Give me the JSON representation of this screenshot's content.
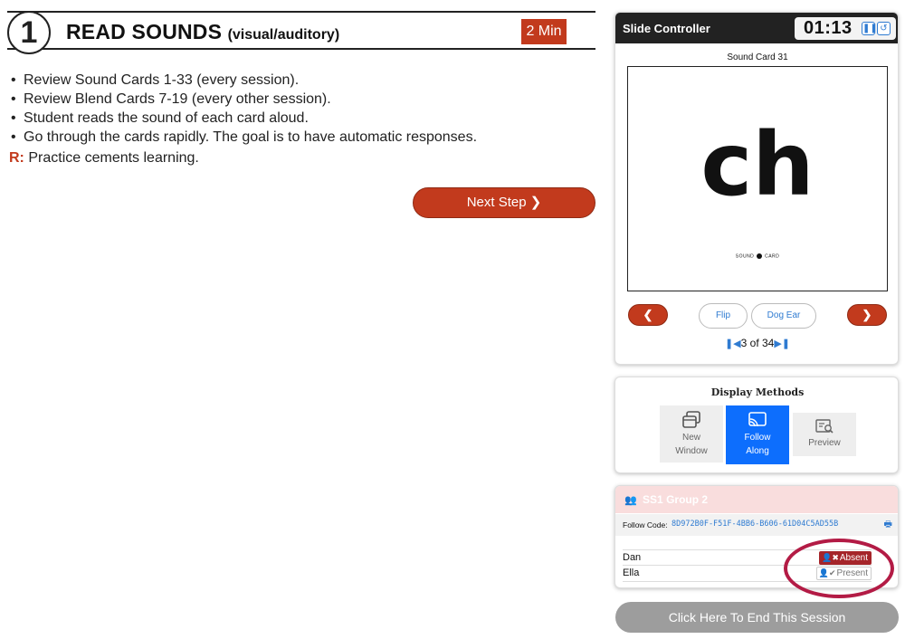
{
  "step": {
    "number": "1",
    "title": "READ SOUNDS",
    "subtitle": "(visual/auditory)",
    "duration": "2 Min"
  },
  "instructions": [
    "Review Sound Cards 1-33 (every session).",
    "Review Blend Cards 7-19 (every other session).",
    "Student reads the sound of each card aloud.",
    "Go through the cards rapidly. The goal is to have automatic responses."
  ],
  "reason": {
    "label": "R:",
    "text": "Practice cements learning."
  },
  "next_step_label": "Next Step ❯",
  "slide_controller": {
    "title": "Slide Controller",
    "timer": "01:13",
    "card_name": "Sound Card 31",
    "card_text": "ch",
    "card_logo_left": "SOUND",
    "card_logo_right": "CARD",
    "flip_label": "Flip",
    "dog_ear_label": "Dog Ear",
    "prev_label": "❮",
    "next_label": "❯",
    "pager_text": "3 of 34",
    "pause_icon": "pause-icon",
    "reset_icon": "reset-icon"
  },
  "display_methods": {
    "title": "Display Methods",
    "options": [
      {
        "label_1": "New",
        "label_2": "Window",
        "active": false,
        "icon": "new-window-icon"
      },
      {
        "label_1": "Follow",
        "label_2": "Along",
        "active": true,
        "icon": "cast-icon"
      },
      {
        "label_1": "Preview",
        "label_2": "",
        "active": false,
        "icon": "preview-icon"
      }
    ]
  },
  "group": {
    "name": "SS1 Group 2",
    "follow_code_label": "Follow Code:",
    "follow_code": "8D972B0F-F51F-4BB6-B606-61D04C5AD55B",
    "students": [
      {
        "name": "Dan",
        "status": "Absent"
      },
      {
        "name": "Ella",
        "status": "Present"
      }
    ]
  },
  "end_session_label": "Click Here To End This Session",
  "colors": {
    "accent_red": "#c23a1d",
    "active_blue": "#0d6efd",
    "link_blue": "#2f7bd1",
    "absent_red": "#a5252a",
    "highlight_ring": "#b31b45",
    "end_button_gray": "#9d9d9d"
  }
}
